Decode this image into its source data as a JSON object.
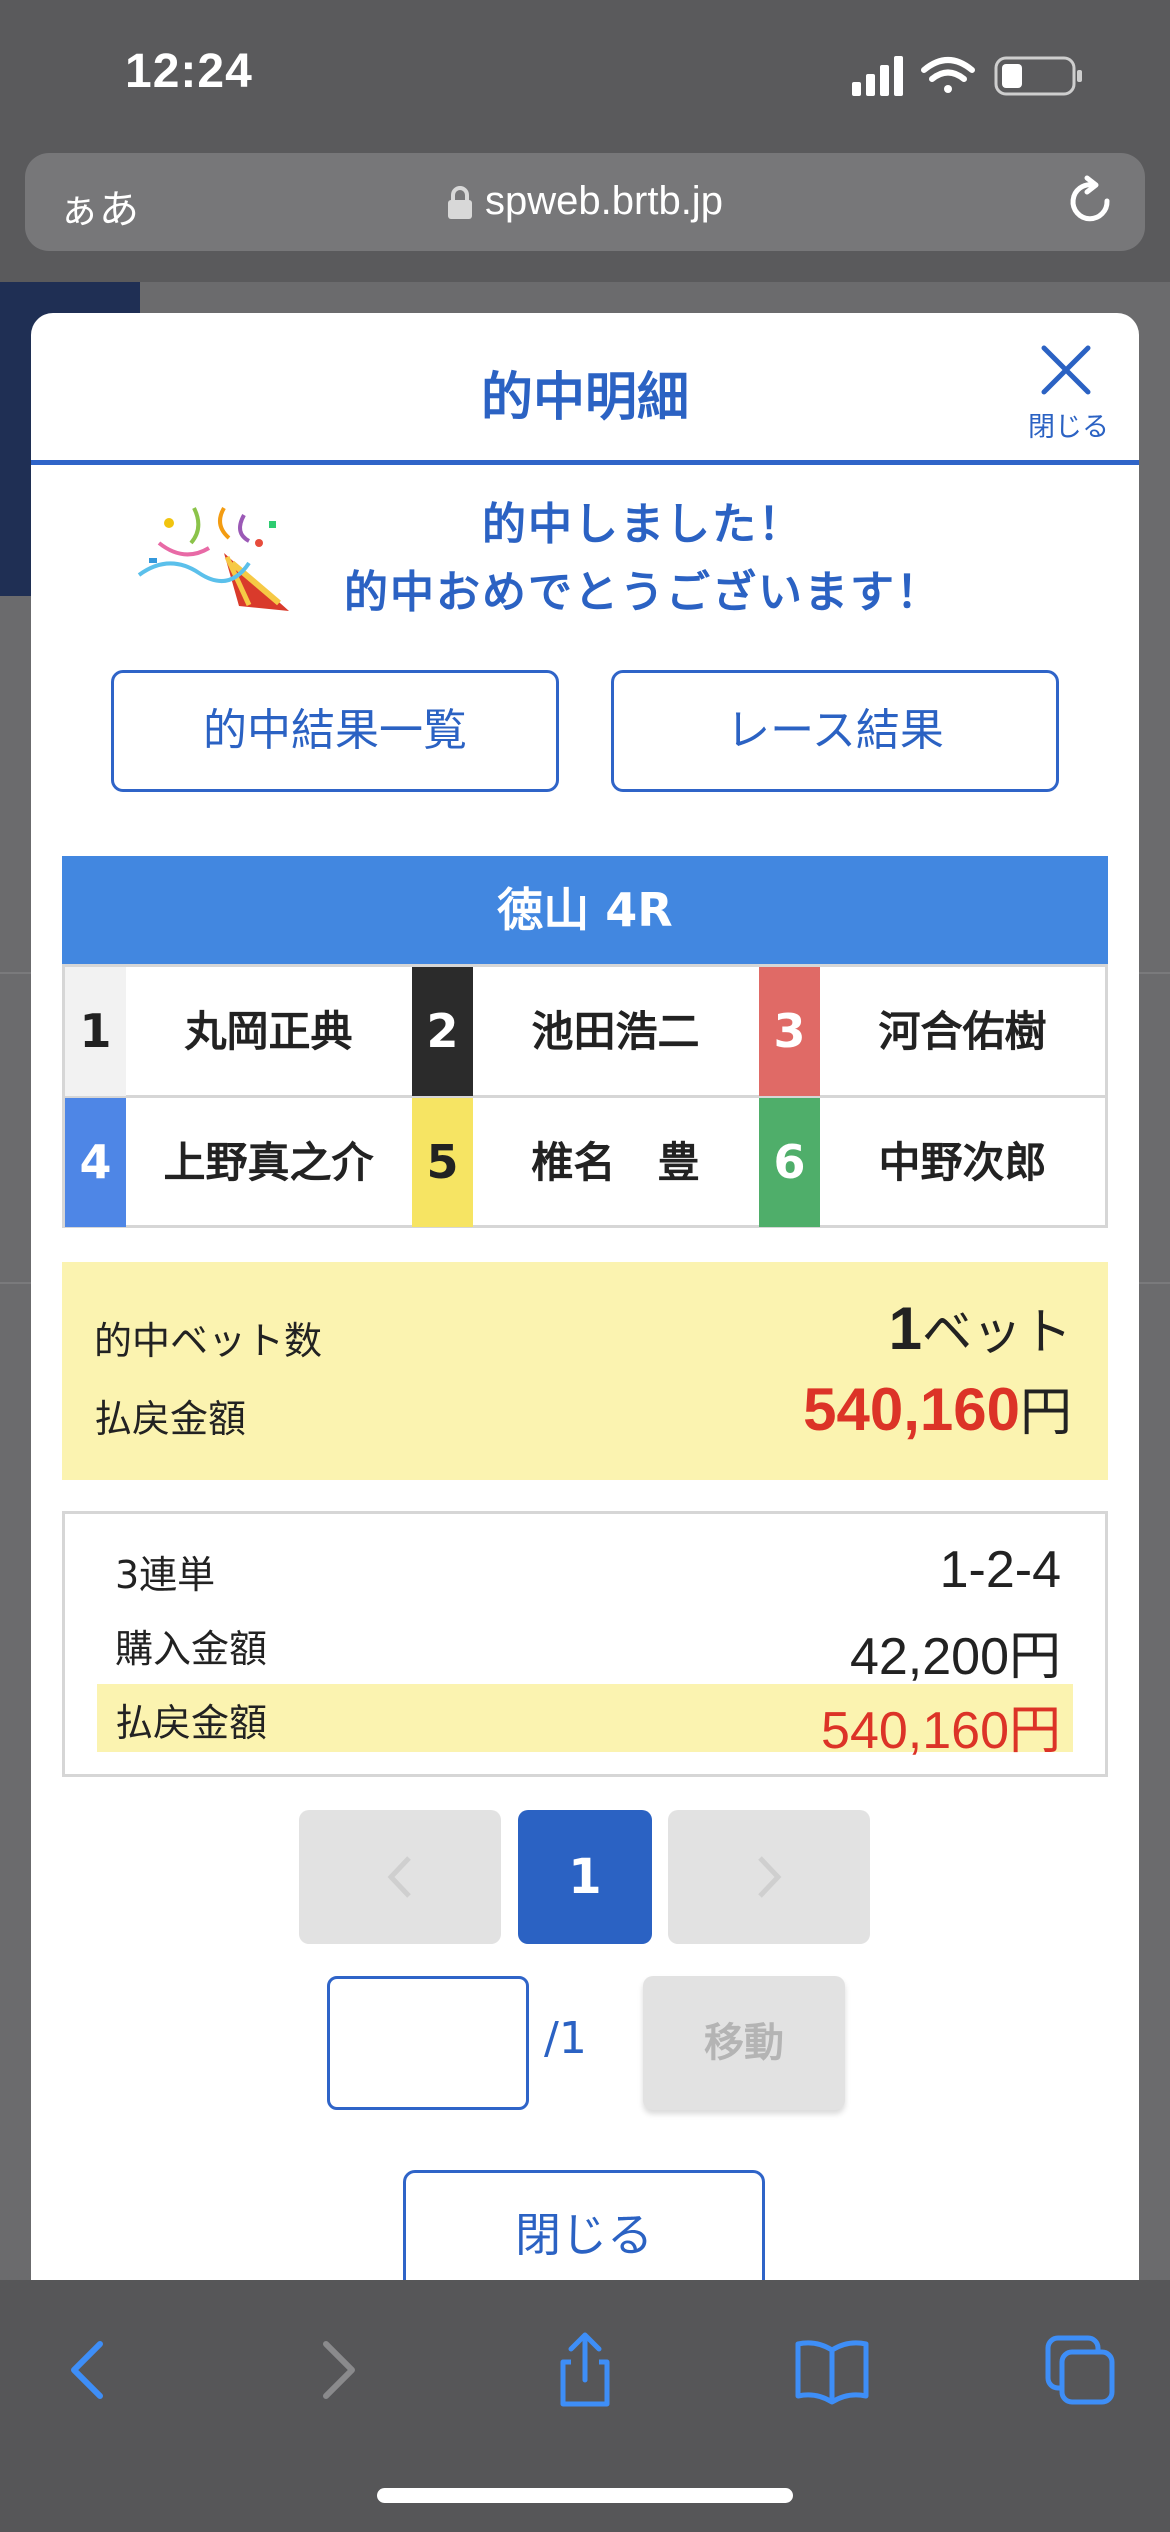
{
  "status_bar": {
    "time": "12:24"
  },
  "url_bar": {
    "text_size_label": "ぁあ",
    "url": "spweb.brtb.jp"
  },
  "modal": {
    "title": "的中明細",
    "close_label": "閉じる",
    "congrats_line1": "的中しました！",
    "congrats_line2": "的中おめでとうございます！",
    "buttons": {
      "results_list": "的中結果一覧",
      "race_result": "レース結果"
    },
    "race": {
      "title": "徳山 4R",
      "racers": [
        {
          "num": "1",
          "name": "丸岡正典",
          "color": "#f2f2f2",
          "num_color": "#222222"
        },
        {
          "num": "2",
          "name": "池田浩二",
          "color": "#2b2b2b",
          "num_color": "#ffffff"
        },
        {
          "num": "3",
          "name": "河合佑樹",
          "color": "#e06a66",
          "num_color": "#ffffff"
        },
        {
          "num": "4",
          "name": "上野真之介",
          "color": "#4e86e6",
          "num_color": "#ffffff"
        },
        {
          "num": "5",
          "name": "椎名　豊",
          "color": "#f6e463",
          "num_color": "#222222"
        },
        {
          "num": "6",
          "name": "中野次郎",
          "color": "#4fae6a",
          "num_color": "#ffffff"
        }
      ]
    },
    "summary": {
      "bet_count_label": "的中ベット数",
      "bet_count_value": "1",
      "bet_count_unit": "ベット",
      "payout_label": "払戻金額",
      "payout_value": "540,160",
      "payout_unit": "円"
    },
    "detail": {
      "bet_type": "3連単",
      "combination": "1-2-4",
      "purchase_label": "購入金額",
      "purchase_value": "42,200円",
      "payout_label": "払戻金額",
      "payout_value": "540,160円"
    },
    "pager": {
      "current": "1",
      "total": "/1",
      "input_value": "",
      "move_label": "移動"
    },
    "close_button": "閉じる"
  },
  "colors": {
    "accent": "#2b62c3",
    "highlight": "#fbf3b0",
    "payout_red": "#dc3327"
  }
}
